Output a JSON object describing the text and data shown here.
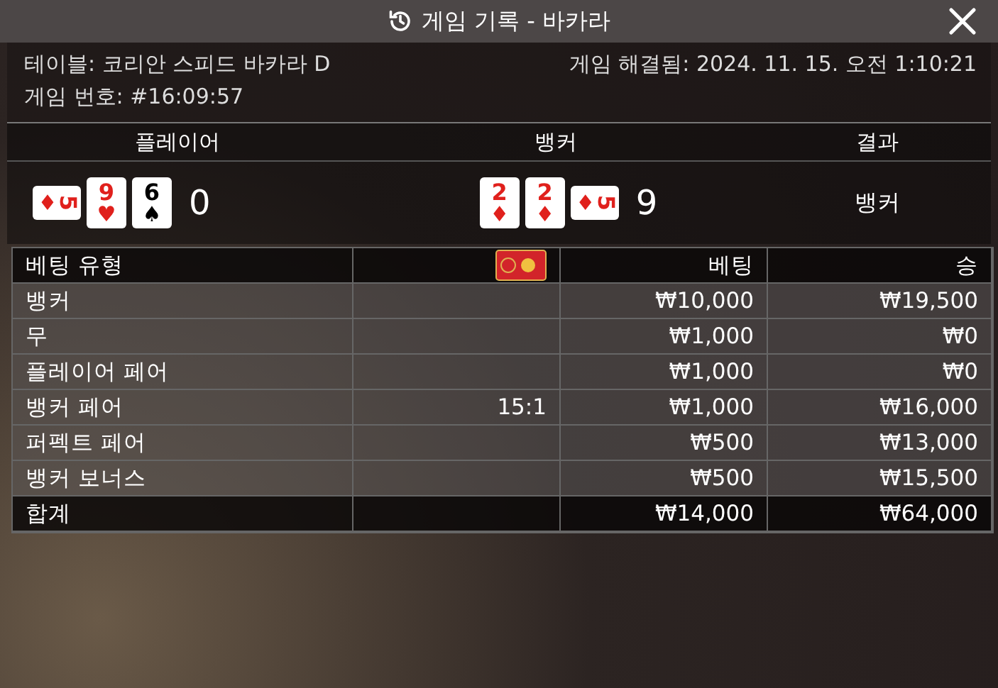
{
  "window": {
    "title": "게임 기록 - 바카라"
  },
  "info": {
    "table": "테이블: 코리안 스피드 바카라 D",
    "resolved": "게임 해결됨: 2024. 11. 15. 오전 1:10:21",
    "game_number": "게임 번호: #16:09:57"
  },
  "hands": {
    "headers": [
      "플레이어",
      "뱅커",
      "결과"
    ],
    "player": {
      "cards": [
        {
          "rank": "5",
          "suit": "♦",
          "color": "#e0201c",
          "rotated": true
        },
        {
          "rank": "9",
          "suit": "♥",
          "color": "#e0201c",
          "rotated": false
        },
        {
          "rank": "6",
          "suit": "♠",
          "color": "#000000",
          "rotated": false
        }
      ],
      "score": "0"
    },
    "banker": {
      "cards": [
        {
          "rank": "2",
          "suit": "♦",
          "color": "#e0201c",
          "rotated": false
        },
        {
          "rank": "2",
          "suit": "♦",
          "color": "#e0201c",
          "rotated": false
        },
        {
          "rank": "5",
          "suit": "♦",
          "color": "#e0201c",
          "rotated": true
        }
      ],
      "score": "9"
    },
    "result": "뱅커"
  },
  "bets": {
    "columns": [
      "베팅 유형",
      "베팅",
      "승"
    ],
    "rows": [
      {
        "kind": "bet",
        "type": "뱅커",
        "odds": "",
        "bet": "₩10,000",
        "win": "₩19,500"
      },
      {
        "kind": "bet",
        "type": "무",
        "odds": "",
        "bet": "₩1,000",
        "win": "₩0"
      },
      {
        "kind": "bet",
        "type": "플레이어 페어",
        "odds": "",
        "bet": "₩1,000",
        "win": "₩0"
      },
      {
        "kind": "bet",
        "type": "뱅커 페어",
        "odds": "15:1",
        "bet": "₩1,000",
        "win": "₩16,000"
      },
      {
        "kind": "bet",
        "type": "퍼펙트 페어",
        "odds": "",
        "bet": "₩500",
        "win": "₩13,000"
      },
      {
        "kind": "bet",
        "type": "뱅커 보너스",
        "odds": "",
        "bet": "₩500",
        "win": "₩15,500"
      },
      {
        "kind": "total",
        "type": "합계",
        "odds": "",
        "bet": "₩14,000",
        "win": "₩64,000"
      }
    ]
  }
}
